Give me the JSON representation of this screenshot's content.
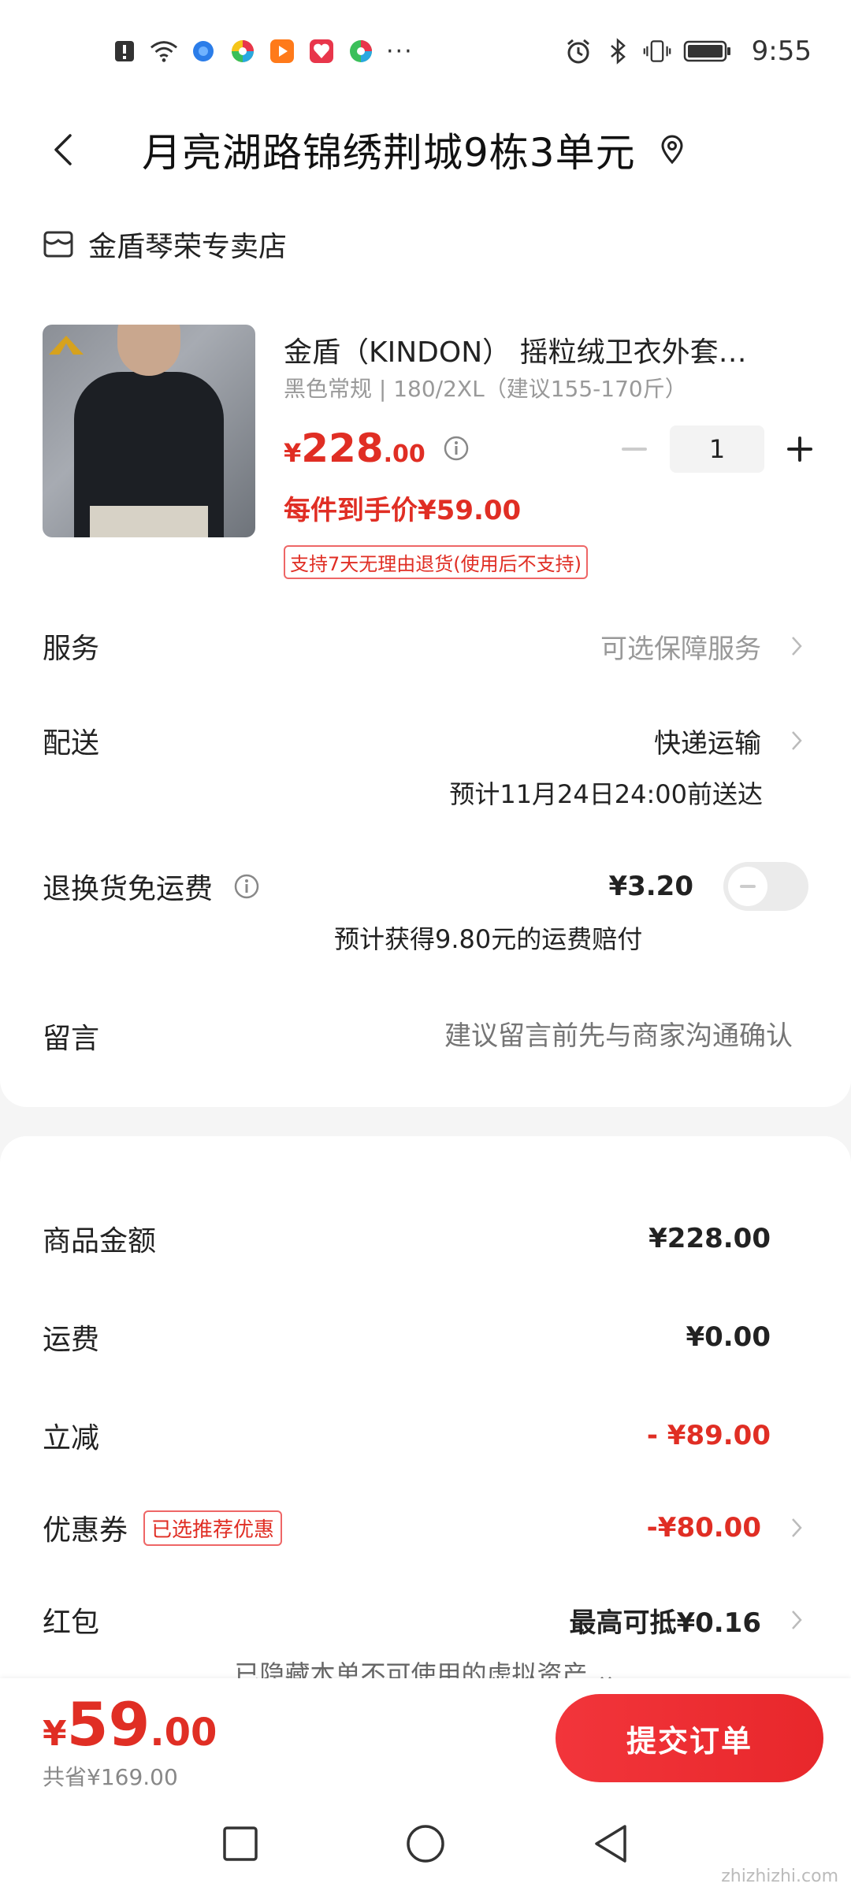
{
  "status_bar": {
    "time": "9:55",
    "more_indicator": "···",
    "left_icons": [
      "alert-icon",
      "wifi-icon",
      "app-icon",
      "app-icon",
      "video-icon",
      "app-icon",
      "app-icon"
    ],
    "right_icons": [
      "alarm-icon",
      "bluetooth-icon",
      "vibrate-icon",
      "battery-icon"
    ]
  },
  "header": {
    "address": "月亮湖路锦绣荆城9栋3单元"
  },
  "shop": {
    "name": "金盾琴荣专卖店"
  },
  "product": {
    "title": "金盾（KINDON） 摇粒绒卫衣外套…",
    "spec": "黑色常规 | 180/2XL（建议155-170斤）",
    "price_symbol": "¥",
    "price_int": "228",
    "price_dec": ".00",
    "quantity": "1",
    "per_item_price": "每件到手价¥59.00",
    "return_policy": "支持7天无理由退货(使用后不支持)"
  },
  "service": {
    "label": "服务",
    "value": "可选保障服务"
  },
  "delivery": {
    "label": "配送",
    "value": "快递运输",
    "eta": "预计11月24日24:00前送达"
  },
  "return_shipping": {
    "label": "退换货免运费",
    "price": "¥3.20",
    "compensation": "预计获得9.80元的运费赔付",
    "enabled": false
  },
  "message": {
    "label": "留言",
    "placeholder": "建议留言前先与商家沟通确认"
  },
  "summary": {
    "goods_label": "商品金额",
    "goods_value": "¥228.00",
    "shipping_label": "运费",
    "shipping_value": "¥0.00",
    "discount_label": "立减",
    "discount_value": "- ¥89.00",
    "coupon_label": "优惠券",
    "coupon_tag": "已选推荐优惠",
    "coupon_value": "-¥80.00",
    "redpacket_label": "红包",
    "redpacket_value": "最高可抵¥0.16",
    "hidden_note": "已隐藏本单不可使用的虚拟资产 ⌄"
  },
  "checkout": {
    "total_symbol": "¥",
    "total_int": "59",
    "total_dec": ".00",
    "saved": "共省¥169.00",
    "submit_label": "提交订单"
  },
  "watermark": "zhizhizhi.com",
  "colors": {
    "accent_red": "#e02e24",
    "muted_gray": "#999999"
  }
}
